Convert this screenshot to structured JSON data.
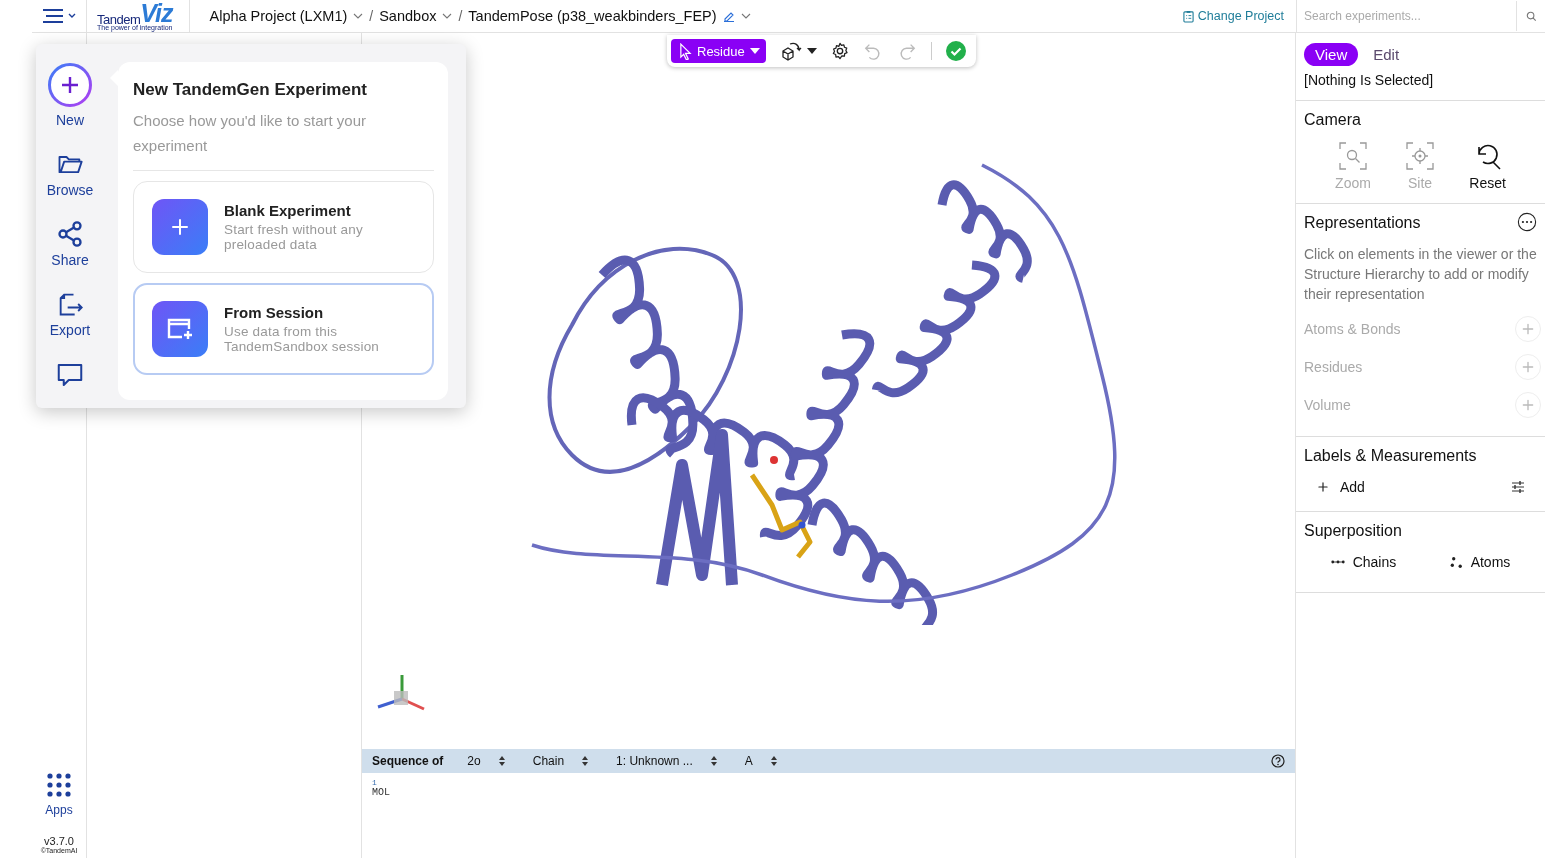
{
  "header": {
    "logo": {
      "word": "Tandem",
      "mark": "Viz",
      "tagline": "The power of integration"
    },
    "breadcrumbs": [
      {
        "label": "Alpha Project (LXM1)"
      },
      {
        "label": "Sandbox",
        "separator": "/"
      },
      {
        "label": "TandemPose (p38_weakbinders_FEP)",
        "separator": "/"
      }
    ],
    "change_project": "Change Project",
    "search": {
      "placeholder": "Search experiments..."
    }
  },
  "toolbar": {
    "mode": "Residue",
    "undo": {
      "disabled": true
    },
    "redo": {
      "disabled": true
    },
    "valid": true
  },
  "rail": {
    "items": [
      {
        "kind": "new",
        "label": "New"
      },
      {
        "kind": "browse",
        "label": "Browse"
      },
      {
        "kind": "share",
        "label": "Share"
      },
      {
        "kind": "export",
        "label": "Export"
      },
      {
        "kind": "comment"
      }
    ],
    "apps": "Apps",
    "version": "v3.7.0",
    "copyright": "©TandemAI"
  },
  "popup": {
    "title": "New TandemGen Experiment",
    "subtitle": "Choose how you'd like to start your experiment",
    "options": [
      {
        "kind": "blank",
        "title": "Blank Experiment",
        "description": "Start fresh without any preloaded data",
        "selected": false
      },
      {
        "kind": "session",
        "title": "From Session",
        "description": "Use data from this TandemSandbox session",
        "selected": true
      }
    ]
  },
  "right_panel": {
    "modes": [
      {
        "label": "View",
        "selected": true
      },
      {
        "label": "Edit",
        "selected": false
      }
    ],
    "selection": "[Nothing Is Selected]",
    "camera": {
      "title": "Camera",
      "buttons": [
        {
          "kind": "zoom",
          "label": "Zoom",
          "disabled": true
        },
        {
          "kind": "site",
          "label": "Site",
          "disabled": true
        },
        {
          "kind": "reset",
          "label": "Reset",
          "disabled": false
        }
      ]
    },
    "representations": {
      "title": "Representations",
      "hint": "Click on elements in the viewer or the Structure Hierarchy to add or modify their representation",
      "items": [
        {
          "label": "Atoms & Bonds",
          "disabled": true
        },
        {
          "label": "Residues",
          "disabled": true
        },
        {
          "label": "Volume",
          "disabled": true
        }
      ]
    },
    "labels": {
      "title": "Labels & Measurements",
      "add": "Add"
    },
    "superposition": {
      "title": "Superposition",
      "items": [
        {
          "kind": "chains",
          "label": "Chains"
        },
        {
          "kind": "atoms",
          "label": "Atoms"
        }
      ]
    }
  },
  "sequence": {
    "title": "Sequence of",
    "selects": [
      "2o",
      "Chain",
      "1: Unknown ...",
      "A"
    ],
    "index": "1",
    "residues": "MOL"
  }
}
